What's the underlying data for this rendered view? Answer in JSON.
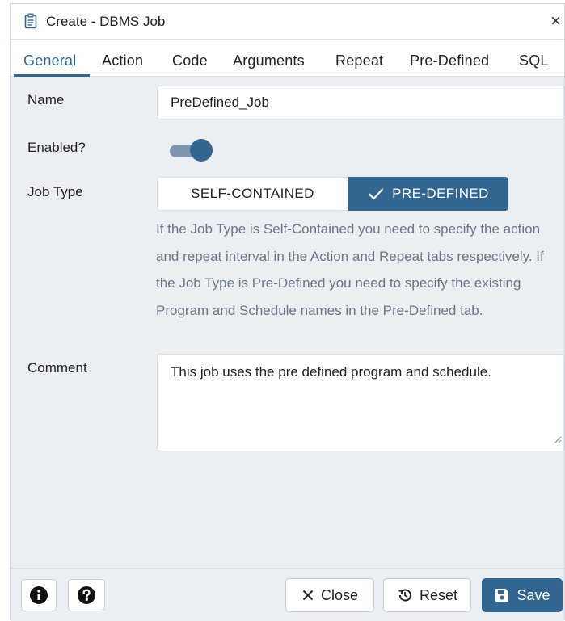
{
  "dialog": {
    "title": "Create - DBMS Job",
    "close_glyph": "×"
  },
  "tabs": [
    {
      "label": "General",
      "active": true
    },
    {
      "label": "Action",
      "active": false
    },
    {
      "label": "Code",
      "active": false
    },
    {
      "label": "Arguments",
      "active": false
    },
    {
      "label": "Repeat",
      "active": false
    },
    {
      "label": "Pre-Defined",
      "active": false
    },
    {
      "label": "SQL",
      "active": false
    }
  ],
  "form": {
    "name_label": "Name",
    "name_value": "PreDefined_Job",
    "enabled_label": "Enabled?",
    "enabled": true,
    "job_type_label": "Job Type",
    "job_type_options": [
      "SELF-CONTAINED",
      "PRE-DEFINED"
    ],
    "job_type_selected": "PRE-DEFINED",
    "job_type_help": "If the Job Type is Self-Contained you need to specify the action and repeat interval in the Action and Repeat tabs respectively. If the Job Type is Pre-Defined you need to specify the existing Program and Schedule names in the Pre-Defined tab.",
    "comment_label": "Comment",
    "comment_value": "This job uses the pre defined program and schedule."
  },
  "footer": {
    "close_label": "Close",
    "reset_label": "Reset",
    "save_label": "Save"
  },
  "colors": {
    "accent": "#326690",
    "background": "#ebeef3",
    "help_text": "#6b7788"
  },
  "icons": [
    "clipboard-icon",
    "close-icon",
    "info-icon",
    "help-icon",
    "x-icon",
    "reset-icon",
    "save-icon",
    "check-icon"
  ]
}
